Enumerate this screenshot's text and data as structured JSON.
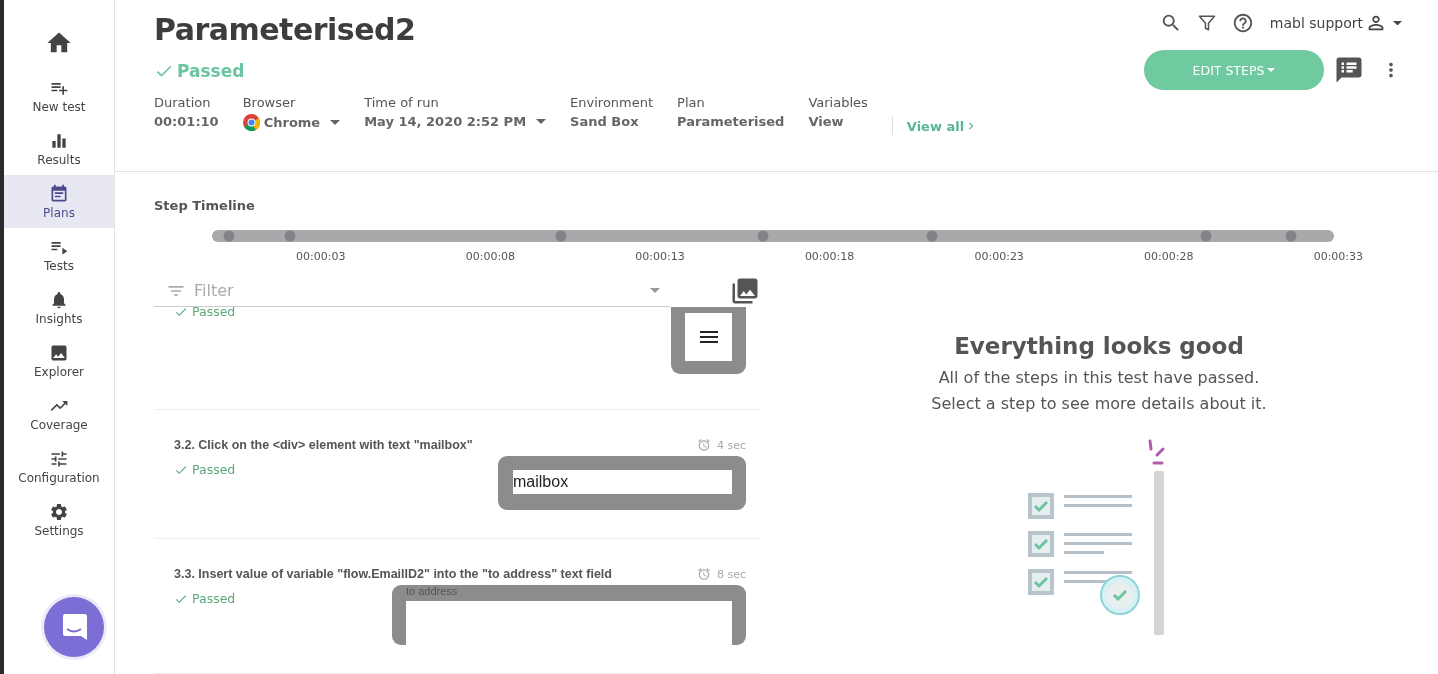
{
  "sidebar": {
    "items": [
      {
        "kind": "home",
        "selected": false
      },
      {
        "kind": "new-test",
        "label": "New test",
        "selected": false
      },
      {
        "kind": "results",
        "label": "Results",
        "selected": false
      },
      {
        "kind": "plans",
        "label": "Plans",
        "selected": true
      },
      {
        "kind": "tests",
        "label": "Tests",
        "selected": false
      },
      {
        "kind": "insights",
        "label": "Insights",
        "selected": false
      },
      {
        "kind": "explorer",
        "label": "Explorer",
        "selected": false
      },
      {
        "kind": "coverage",
        "label": "Coverage",
        "selected": false
      },
      {
        "kind": "configuration",
        "label": "Configuration",
        "selected": false
      },
      {
        "kind": "settings",
        "label": "Settings",
        "selected": false
      }
    ]
  },
  "topbar": {
    "user": "mabl support"
  },
  "header": {
    "title": "Parameterised2",
    "status": "Passed",
    "edit_button": "EDIT STEPS",
    "meta": [
      {
        "kind": "text",
        "label": "Duration",
        "value": "00:01:10"
      },
      {
        "kind": "browser",
        "label": "Browser",
        "value": "Chrome"
      },
      {
        "kind": "dropdown",
        "label": "Time of run",
        "value": "May 14, 2020 2:52 PM"
      },
      {
        "kind": "text",
        "label": "Environment",
        "value": "Sand Box"
      },
      {
        "kind": "text",
        "label": "Plan",
        "value": "Parameterised"
      },
      {
        "kind": "text",
        "label": "Variables",
        "value": "View"
      }
    ],
    "view_all": "View all"
  },
  "timeline": {
    "title": "Step Timeline",
    "ticks": [
      "00:00:03",
      "00:00:08",
      "00:00:13",
      "00:00:18",
      "00:00:23",
      "00:00:28",
      "00:00:33"
    ]
  },
  "filter": {
    "placeholder": "Filter"
  },
  "steps": [
    {
      "status": "Passed",
      "thumb": {
        "kind": "menu"
      }
    },
    {
      "title": "3.2. Click on the <div> element with text \"mailbox\"",
      "duration": "4 sec",
      "status": "Passed",
      "thumb": {
        "kind": "input",
        "text": "mailbox"
      }
    },
    {
      "title": "3.3. Insert value of variable \"flow.EmailID2\" into the \"to address\" text field",
      "duration": "8 sec",
      "status": "Passed",
      "thumb": {
        "kind": "labeled",
        "text": "to address"
      }
    }
  ],
  "empty_state": {
    "title": "Everything looks good",
    "lines": [
      "All of the steps in this test have passed.",
      "Select a step to see more details about it."
    ]
  }
}
